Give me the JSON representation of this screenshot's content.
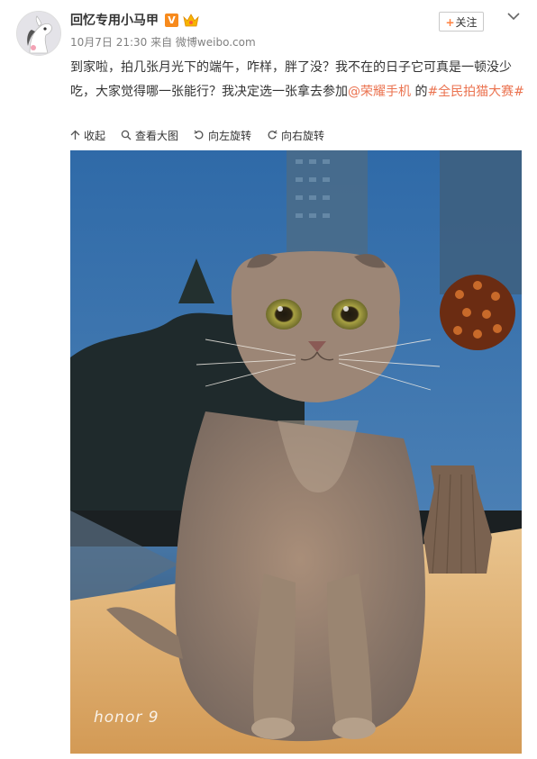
{
  "post": {
    "username": "回忆专用小马甲",
    "verified_badge": "V",
    "meta": "10月7日 21:30 来自 微博weibo.com",
    "follow_label": "+关注",
    "follow_text": "关注",
    "text_part1": "到家啦，拍几张月光下的端午，咋样，胖了没？我不在的日子它可真是一顿没少吃，大家觉得哪一张能行？我决定选一张拿去参加",
    "mention": "@荣耀手机",
    "text_part2": " 的",
    "topic": "#全民拍猫大赛#"
  },
  "toolbar": {
    "collapse_label": "收起",
    "view_large_label": "查看大图",
    "rotate_left_label": "向左旋转",
    "rotate_right_label": "向右旋转"
  },
  "photo": {
    "watermark": "honor 9"
  },
  "colors": {
    "link": "#eb7350",
    "vbadge": "#f78a1d"
  }
}
